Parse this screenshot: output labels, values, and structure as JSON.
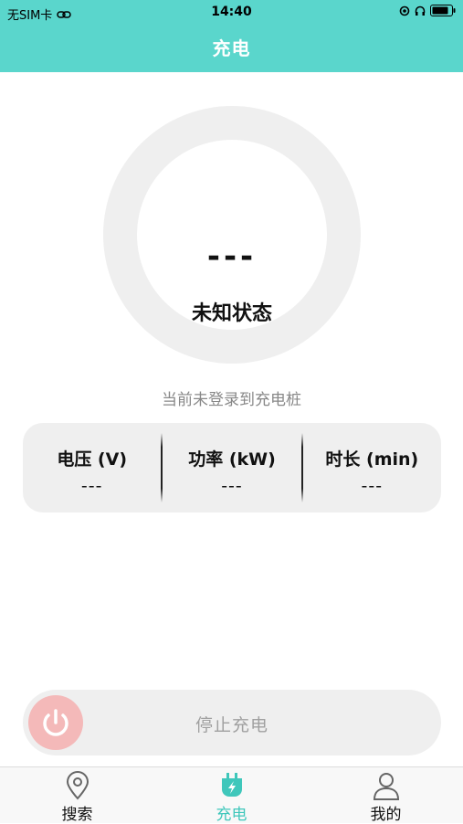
{
  "status": {
    "carrier": "无SIM卡",
    "time": "14:40"
  },
  "header": {
    "title": "充电"
  },
  "gauge": {
    "value": "---",
    "state": "未知状态"
  },
  "login_tip": "当前未登录到充电桩",
  "metrics": [
    {
      "label": "电压 (V)",
      "value": "---"
    },
    {
      "label": "功率 (kW)",
      "value": "---"
    },
    {
      "label": "时长 (min)",
      "value": "---"
    }
  ],
  "stop_button": {
    "label": "停止充电"
  },
  "tabs": [
    {
      "label": "搜索",
      "icon": "location-pin-icon",
      "active": false
    },
    {
      "label": "充电",
      "icon": "charging-plug-icon",
      "active": true
    },
    {
      "label": "我的",
      "icon": "user-icon",
      "active": false
    }
  ],
  "colors": {
    "accent": "#5ad6cc",
    "tab_active": "#3fc7bb",
    "power_button": "#f4b9b9"
  }
}
